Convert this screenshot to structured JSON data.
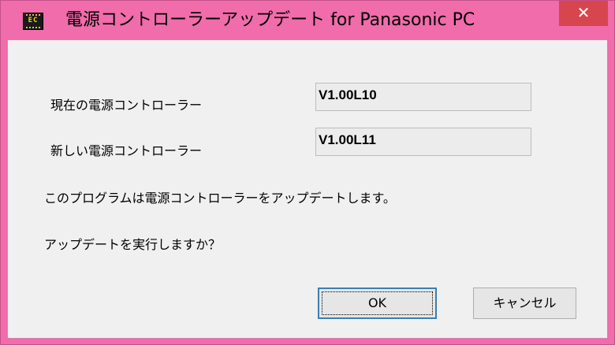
{
  "window": {
    "title": "電源コントローラーアップデート for Panasonic PC",
    "icon_text": "EC",
    "icon_name": "ec-chip-icon",
    "close_label": "✕",
    "accent_color": "#f06caa"
  },
  "form": {
    "current_label": "現在の電源コントローラー",
    "current_value": "V1.00L10",
    "new_label": "新しい電源コントローラー",
    "new_value": "V1.00L11",
    "message": "このプログラムは電源コントローラーをアップデートします。",
    "question": "アップデートを実行しますか？"
  },
  "buttons": {
    "ok_label": "OK",
    "cancel_label": "キャンセル"
  }
}
